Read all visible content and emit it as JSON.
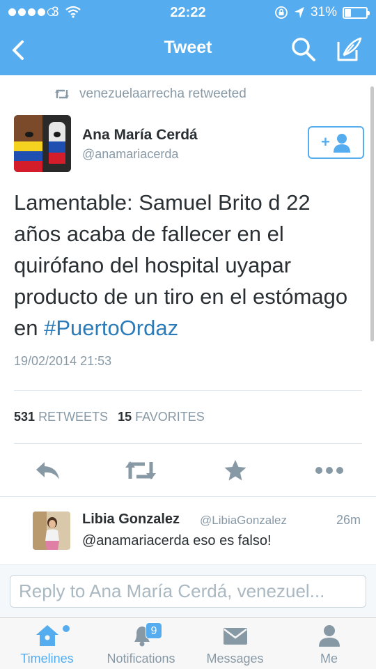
{
  "status_bar": {
    "carrier": "3",
    "time": "22:22",
    "battery": "31%",
    "battery_level": 0.31
  },
  "nav": {
    "title": "Tweet",
    "back_icon": "chevron-left-icon",
    "search_icon": "search-icon",
    "compose_icon": "compose-icon"
  },
  "tweet": {
    "retweeted_by": "venezuelaarrecha retweeted",
    "author_name": "Ana María Cerdá",
    "author_handle": "@anamariacerda",
    "follow_label": "+",
    "text": "Lamentable: Samuel Brito d 22 años acaba de fallecer en el quirófano del hospital uyapar producto de un tiro en el estómago en ",
    "hashtag": "#PuertoOrdaz",
    "date": "19/02/2014 21:53",
    "retweet_count": "531",
    "retweet_label": "RETWEETS",
    "favorite_count": "15",
    "favorite_label": "FAVORITES"
  },
  "actions": [
    "reply-icon",
    "retweet-icon",
    "favorite-icon",
    "more-icon"
  ],
  "reply": {
    "name": "Libia Gonzalez",
    "handle": "@LibiaGonzalez",
    "time": "26m",
    "text": "@anamariacerda eso es falso!"
  },
  "composer": {
    "placeholder": "Reply to Ana María Cerdá, venezuel..."
  },
  "tabs": [
    {
      "label": "Timelines",
      "icon": "home-icon",
      "active": true
    },
    {
      "label": "Notifications",
      "icon": "bell-icon",
      "badge": "9"
    },
    {
      "label": "Messages",
      "icon": "envelope-icon"
    },
    {
      "label": "Me",
      "icon": "person-icon"
    }
  ],
  "colors": {
    "brand": "#55acee",
    "link": "#2b7bb9",
    "muted": "#8899a6",
    "text": "#292f33"
  }
}
